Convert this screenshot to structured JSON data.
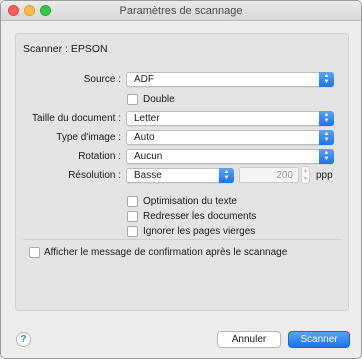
{
  "window": {
    "title": "Paramètres de scannage"
  },
  "scanner": {
    "label": "Scanner : EPSON"
  },
  "source": {
    "label": "Source :",
    "value": "ADF"
  },
  "double": {
    "label": "Double",
    "checked": false
  },
  "doc_size": {
    "label": "Taille du document :",
    "value": "Letter"
  },
  "image_type": {
    "label": "Type d'image :",
    "value": "Auto"
  },
  "rotation": {
    "label": "Rotation :",
    "value": "Aucun"
  },
  "resolution": {
    "label": "Résolution :",
    "value": "Basse",
    "dpi": "200",
    "unit": "ppp"
  },
  "options": [
    {
      "label": "Optimisation du texte",
      "checked": false
    },
    {
      "label": "Redresser les documents",
      "checked": false
    },
    {
      "label": "Ignorer les pages vierges",
      "checked": false
    }
  ],
  "confirm": {
    "label": "Afficher le message de confirmation après le scannage",
    "checked": false
  },
  "buttons": {
    "help": "?",
    "cancel": "Annuler",
    "scan": "Scanner"
  },
  "colors": {
    "accent": "#1a74ed",
    "close": "#fc605c",
    "minimize": "#fdbc40",
    "maximize": "#34c84a"
  },
  "icons": {
    "popup_arrows": "up-down-chevron-icon",
    "help": "question-mark-icon"
  }
}
